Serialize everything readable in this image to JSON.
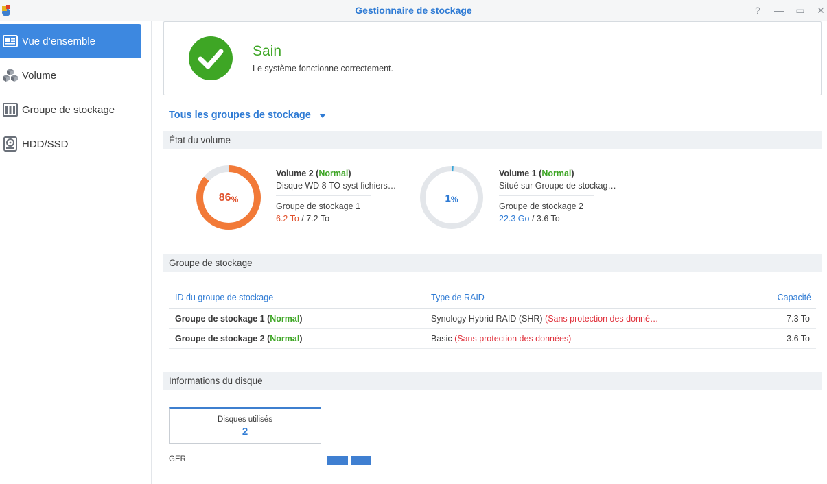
{
  "window": {
    "title": "Gestionnaire de stockage",
    "help_glyph": "?",
    "minimize_glyph": "—",
    "maximize_glyph": "▭",
    "close_glyph": "✕"
  },
  "sidebar": {
    "items": [
      {
        "label": "Vue d’ensemble",
        "icon": "overview-icon",
        "active": true
      },
      {
        "label": "Volume",
        "icon": "cubes-icon",
        "active": false
      },
      {
        "label": "Groupe de stockage",
        "icon": "storage-pool-icon",
        "active": false
      },
      {
        "label": "HDD/SSD",
        "icon": "hdd-icon",
        "active": false
      }
    ]
  },
  "health": {
    "status": "Sain",
    "description": "Le système fonctionne correctement.",
    "color": "#3ea625"
  },
  "filter": {
    "label": "Tous les groupes de stockage"
  },
  "sections": {
    "volume_state": "État du volume",
    "storage_pool": "Groupe de stockage",
    "disk_info": "Informations du disque"
  },
  "volumes": [
    {
      "name": "Volume 2",
      "status": "Normal",
      "description": "Disque WD 8 TO syst fichiers…",
      "pool": "Groupe de stockage 1",
      "used": "6.2 To",
      "total": "7.2 To",
      "percent_value": "86",
      "percent_sign": "%",
      "usage_fraction": 0.86,
      "ring_color": "#f27a38"
    },
    {
      "name": "Volume 1",
      "status": "Normal",
      "description": "Situé sur Groupe de stockag…",
      "pool": "Groupe de stockage 2",
      "used": "22.3 Go",
      "total": "3.6 To",
      "percent_value": "1",
      "percent_sign": "%",
      "usage_fraction": 0.01,
      "ring_color": "#35a4d8"
    }
  ],
  "pool_table": {
    "headers": {
      "id": "ID du groupe de stockage",
      "raid": "Type de RAID",
      "capacity": "Capacité"
    },
    "rows": [
      {
        "name": "Groupe de stockage 1",
        "status": "Normal",
        "raid": "Synology Hybrid RAID (SHR)",
        "warning": "(Sans protection des donné…",
        "capacity": "7.3 To"
      },
      {
        "name": "Groupe de stockage 2",
        "status": "Normal",
        "raid": "Basic",
        "warning": "(Sans protection des données)",
        "capacity": "3.6 To"
      }
    ]
  },
  "disk_info": {
    "used_label": "Disques utilisés",
    "used_count": "2",
    "group_label": "GER"
  }
}
